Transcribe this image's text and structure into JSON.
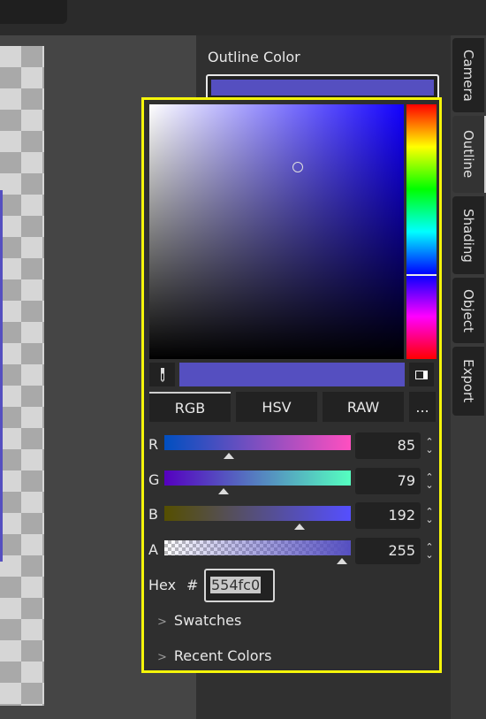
{
  "header": {
    "outline_label": "Outline Color"
  },
  "current_color": "#554fc0",
  "side_tabs": [
    {
      "label": "Camera",
      "active": false
    },
    {
      "label": "Outline",
      "active": true
    },
    {
      "label": "Shading",
      "active": false
    },
    {
      "label": "Object",
      "active": false
    },
    {
      "label": "Export",
      "active": false
    }
  ],
  "picker": {
    "mode_tabs": [
      "RGB",
      "HSV",
      "RAW",
      "..."
    ],
    "active_mode": "RGB",
    "channels": [
      {
        "label": "R",
        "value": "85"
      },
      {
        "label": "G",
        "value": "79"
      },
      {
        "label": "B",
        "value": "192"
      },
      {
        "label": "A",
        "value": "255"
      }
    ],
    "hex_label": "Hex",
    "hex_hash": "#",
    "hex_value": "554fc0",
    "sections": [
      "Swatches",
      "Recent Colors"
    ],
    "icons": {
      "picker": "eyedropper-icon",
      "mode": "preview-mode-icon",
      "spin": "spin-arrows-icon",
      "chevron": "chevron-right-icon"
    },
    "highlight_color": "#f5f50a"
  }
}
